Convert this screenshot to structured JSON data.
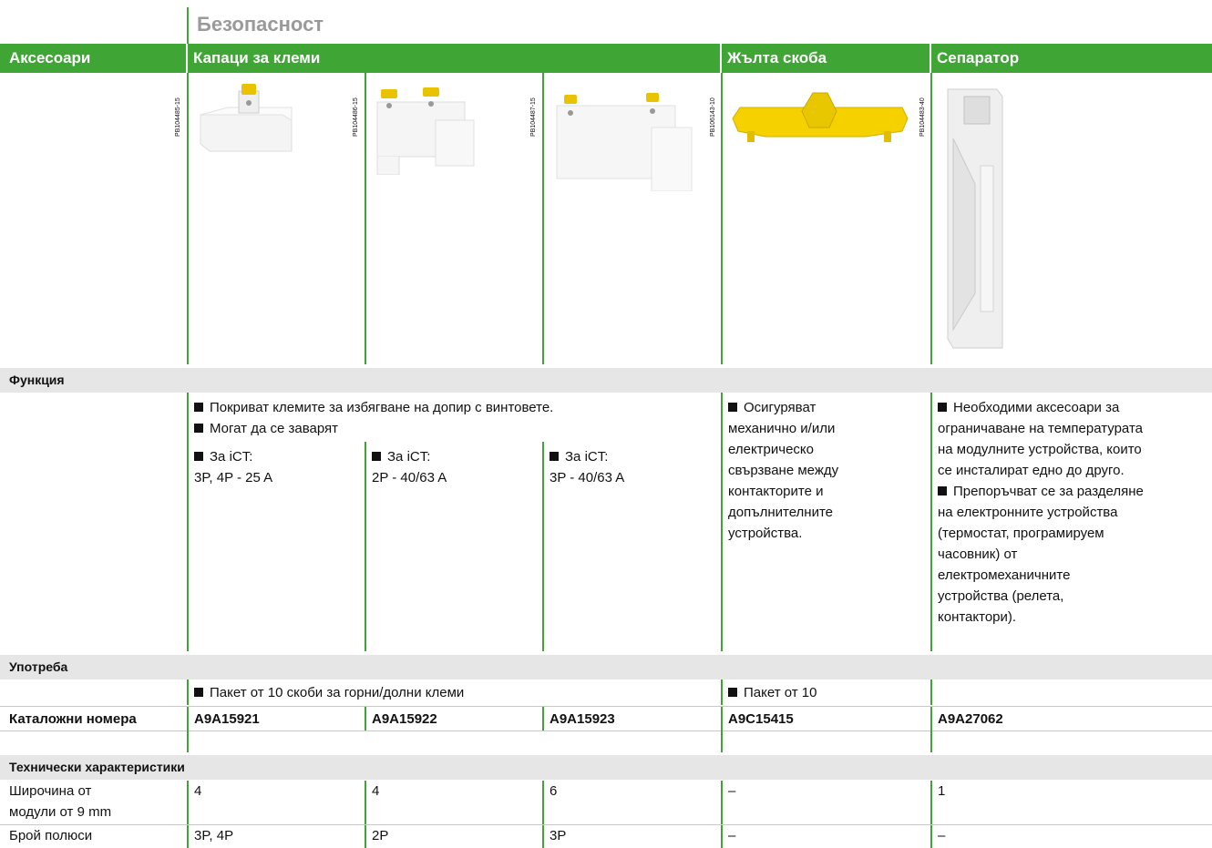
{
  "section_title": "Безопасност",
  "header": {
    "accessories": "Аксесоари",
    "terminal_covers": "Капаци за клеми",
    "yellow_clip": "Жълта скоба",
    "separator": "Сепаратор"
  },
  "image_codes": [
    "PB104485-15",
    "PB104486-15",
    "PB104487-15",
    "PB106143-10",
    "PB104483-40"
  ],
  "function": {
    "label": "Функция",
    "covers_line1": "Покриват клемите за избягване на допир с винтовете.",
    "covers_line2": "Могат да се заварят",
    "cover1": [
      "За iCT:",
      "3P, 4P - 25 A"
    ],
    "cover2": [
      "За iCT:",
      "2P - 40/63 A"
    ],
    "cover3": [
      "За iCT:",
      "3P - 40/63 A"
    ],
    "clip_lines": [
      "Осигуряват",
      "механично и/или",
      "електрическо",
      "свързване между",
      "контакторите и",
      "допълнителните",
      "устройства."
    ],
    "separator_lines": [
      "Необходими аксесоари за",
      "ограничаване на температурата",
      "на модулните устройства, които",
      "се инсталират едно до друго.",
      "Препоръчват се за разделяне",
      "на електронните устройства",
      "(термостат, програмируем",
      "часовник) от",
      "електромеханичните",
      "устройства (релета,",
      "контактори)."
    ]
  },
  "usage": {
    "label": "Употреба",
    "covers": "Пакет от 10 скоби за горни/долни клеми",
    "clip": "Пакет от 10"
  },
  "catalog": {
    "label": "Каталожни номера",
    "numbers": [
      "A9A15921",
      "A9A15922",
      "A9A15923",
      "A9C15415",
      "A9A27062"
    ]
  },
  "tech": {
    "label": "Технически характеристики",
    "width_label": [
      "Широчина от",
      "модули от 9 mm"
    ],
    "width_values": [
      "4",
      "4",
      "6",
      "–",
      "1"
    ],
    "poles_label": "Брой полюси",
    "poles_values": [
      "3P, 4P",
      "2P",
      "3P",
      "–",
      "–"
    ]
  },
  "colors": {
    "accent": "#3fa535",
    "row_bg": "#e6e6e6",
    "clip_yellow": "#f5d100"
  }
}
